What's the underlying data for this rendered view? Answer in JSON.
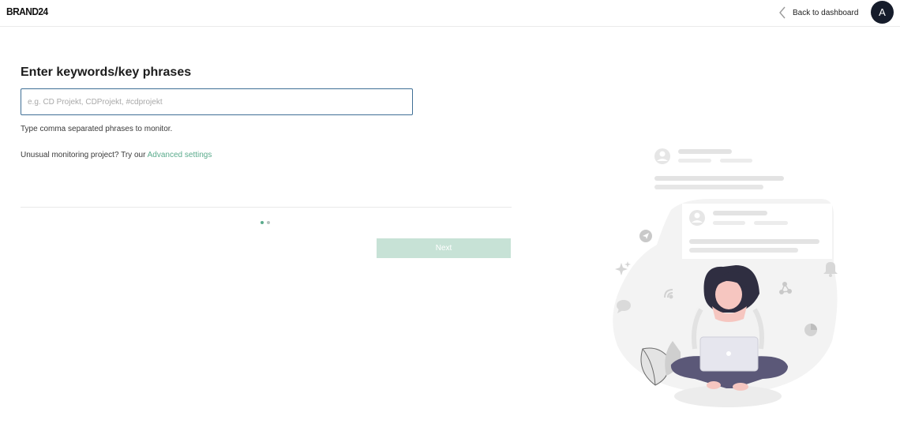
{
  "header": {
    "logo": "BRAND24",
    "back_label": "Back to dashboard",
    "avatar_initial": "A"
  },
  "form": {
    "title": "Enter keywords/key phrases",
    "input_value": "",
    "input_placeholder": "e.g. CD Projekt, CDProjekt, #cdprojekt",
    "hint": "Type comma separated phrases to monitor.",
    "advanced_prefix": "Unusual monitoring project? Try our ",
    "advanced_link": "Advanced settings",
    "next_label": "Next"
  },
  "steps": {
    "total": 2,
    "current": 1
  },
  "colors": {
    "accent": "#5aab8c",
    "button_disabled": "#c7e2d6",
    "avatar_bg": "#161c2b",
    "input_border": "#3f6f96",
    "step_active": "#5aab8c",
    "step_inactive": "#b9c3c0"
  },
  "icons": [
    "chevron-left-icon",
    "user-avatar-icon",
    "send-icon",
    "sparkle-icon",
    "chat-bubble-icon",
    "rss-icon",
    "share-icon",
    "bell-icon",
    "pie-chart-icon"
  ]
}
